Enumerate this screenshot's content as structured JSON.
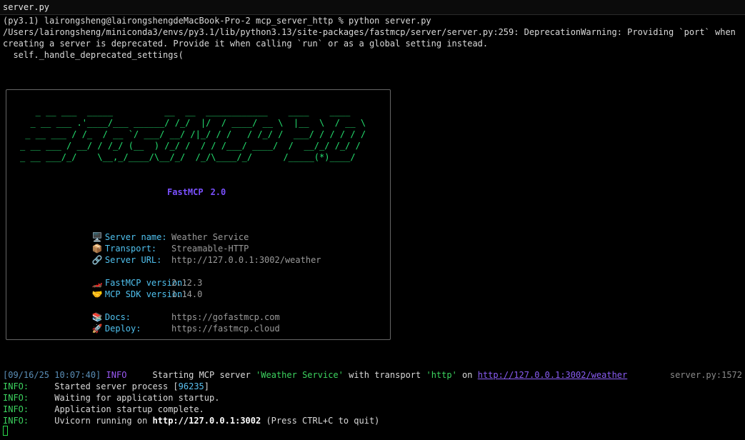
{
  "window": {
    "tab_title": "server.py"
  },
  "command": {
    "prompt": "(py3.1) lairongsheng@lairongshengdeMacBook-Pro-2 mcp_server_http % python server.py"
  },
  "warning": {
    "text": "/Users/lairongsheng/miniconda3/envs/py3.1/lib/python3.13/site-packages/fastmcp/server/server.py:259: DeprecationWarning: Providing `port` when creating a server is deprecated. Provide it when calling `run` or as a global setting instead.",
    "call": "  self._handle_deprecated_settings("
  },
  "banner": {
    "ascii_art": "   _ __ ___  _____          __  __  ____________    ____    ____ \n  _ __ ___ .'____/___ ______/ /_/  |/  / ____/ __ \\  |__  \\  / __ \\\n _ __ ___ / /_  / __ `/ ___/ __/ /|_/ / /   / /_/ /  ___/ / / / / /\n_ __ ___ / __/ / /_/ (__  ) /_/ /  / / /___/ ____/  /  __/_/ /_/ / \n_ __ ___/_/    \\__,_/____/\\__/_/  /_/\\____/_/      /_____(*)____/  ",
    "brand_name": "FastMCP",
    "brand_version": "2.0",
    "info": [
      {
        "icon": "🖥️",
        "icon_name": "computer-icon",
        "label": "Server name:",
        "value": "Weather Service"
      },
      {
        "icon": "📦",
        "icon_name": "package-icon",
        "label": "Transport:",
        "value": "Streamable-HTTP"
      },
      {
        "icon": "🔗",
        "icon_name": "link-icon",
        "label": "Server URL:",
        "value": "http://127.0.0.1:3002/weather"
      }
    ],
    "versions": [
      {
        "icon": "🏎️",
        "icon_name": "race-car-icon",
        "label": "FastMCP version:",
        "value": "2.12.3"
      },
      {
        "icon": "🤝",
        "icon_name": "handshake-icon",
        "label": "MCP SDK version:",
        "value": "1.14.0"
      }
    ],
    "links": [
      {
        "icon": "📚",
        "icon_name": "books-icon",
        "label": "Docs:",
        "value": "https://gofastmcp.com"
      },
      {
        "icon": "🚀",
        "icon_name": "rocket-icon",
        "label": "Deploy:",
        "value": "https://fastmcp.cloud"
      }
    ]
  },
  "log": {
    "timestamp": "[09/16/25 10:07:40]",
    "level": "INFO",
    "msg_start": "Starting MCP server ",
    "server_name": "'Weather Service'",
    "msg_with": " with transport ",
    "transport": "'http'",
    "msg_on": " on ",
    "url": "http://127.0.0.1:3002/weather",
    "source": "server.py:1572"
  },
  "uvicorn": [
    {
      "level": "INFO:",
      "pre": "     Started server process [",
      "pid": "96235",
      "post": "]"
    },
    {
      "level": "INFO:",
      "pre": "     Waiting for application startup.",
      "pid": "",
      "post": ""
    },
    {
      "level": "INFO:",
      "pre": "     Application startup complete.",
      "pid": "",
      "post": ""
    }
  ],
  "uvicorn_running": {
    "level": "INFO:",
    "pre": "     Uvicorn running on ",
    "address": "http://127.0.0.1:3002",
    "post": " (Press CTRL+C to quit)"
  }
}
